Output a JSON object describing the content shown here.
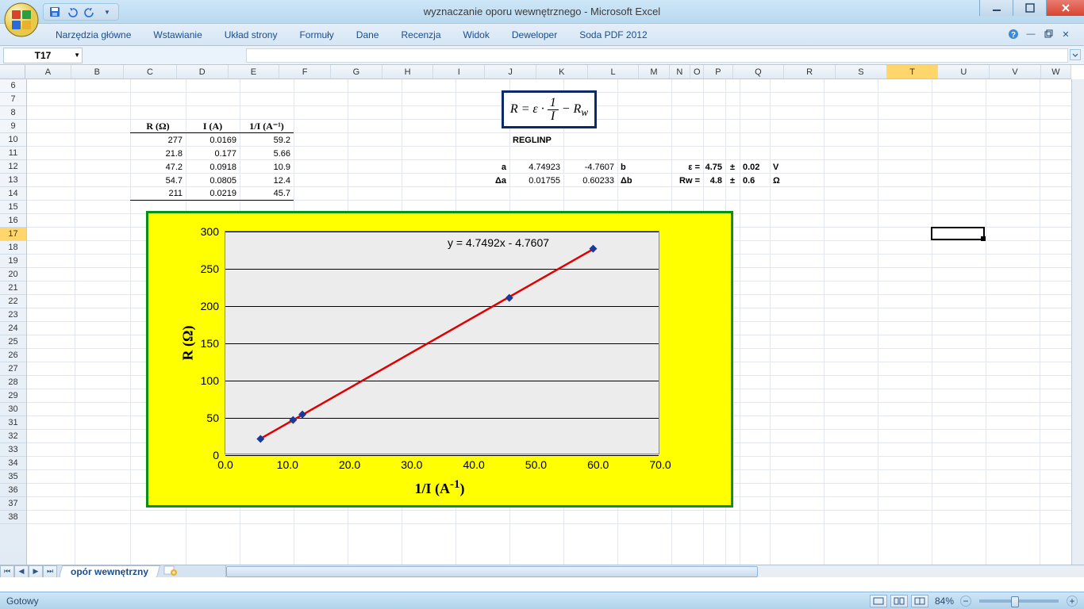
{
  "window": {
    "title": "wyznaczanie oporu wewnętrznego - Microsoft Excel"
  },
  "ribbon_tabs": [
    "Narzędzia główne",
    "Wstawianie",
    "Układ strony",
    "Formuły",
    "Dane",
    "Recenzja",
    "Widok",
    "Deweloper",
    "Soda PDF 2012"
  ],
  "name_box": "T17",
  "columns": [
    {
      "l": "A",
      "w": 60
    },
    {
      "l": "B",
      "w": 70
    },
    {
      "l": "C",
      "w": 70
    },
    {
      "l": "D",
      "w": 68
    },
    {
      "l": "E",
      "w": 68
    },
    {
      "l": "F",
      "w": 68
    },
    {
      "l": "G",
      "w": 68
    },
    {
      "l": "H",
      "w": 68
    },
    {
      "l": "I",
      "w": 68
    },
    {
      "l": "J",
      "w": 68
    },
    {
      "l": "K",
      "w": 68
    },
    {
      "l": "L",
      "w": 68
    },
    {
      "l": "M",
      "w": 40
    },
    {
      "l": "N",
      "w": 28
    },
    {
      "l": "O",
      "w": 18
    },
    {
      "l": "P",
      "w": 38
    },
    {
      "l": "Q",
      "w": 68
    },
    {
      "l": "R",
      "w": 68
    },
    {
      "l": "S",
      "w": 68
    },
    {
      "l": "T",
      "w": 68
    },
    {
      "l": "U",
      "w": 68
    },
    {
      "l": "V",
      "w": 68
    },
    {
      "l": "W",
      "w": 40
    }
  ],
  "row_start": 6,
  "row_end": 38,
  "active_col": "T",
  "active_row": 17,
  "table": {
    "headers": {
      "c": "R (Ω)",
      "d": "I (A)",
      "e": "1/I (A⁻¹)"
    },
    "rows": [
      {
        "c": "277",
        "d": "0.0169",
        "e": "59.2"
      },
      {
        "c": "21.8",
        "d": "0.177",
        "e": "5.66"
      },
      {
        "c": "47.2",
        "d": "0.0918",
        "e": "10.9"
      },
      {
        "c": "54.7",
        "d": "0.0805",
        "e": "12.4"
      },
      {
        "c": "211",
        "d": "0.0219",
        "e": "45.7"
      }
    ]
  },
  "formula_image": "R = ε · 1/I − Rw",
  "reglinp": {
    "label": "REGLINP",
    "a_label": "a",
    "a_val": "4.74923",
    "b_val": "-4.7607",
    "b_label": "b",
    "da_label": "Δa",
    "da_val": "0.01755",
    "db_val": "0.60233",
    "db_label": "Δb"
  },
  "results": {
    "eps_label": "ε =",
    "eps_val": "4.75",
    "pm1": "±",
    "eps_err": "0.02",
    "eps_unit": "V",
    "rw_label": "Rw =",
    "rw_val": "4.8",
    "pm2": "±",
    "rw_err": "0.6",
    "rw_unit": "Ω"
  },
  "chart_data": {
    "type": "scatter",
    "equation": "y = 4.7492x - 4.7607",
    "xlabel": "1/I (A⁻¹)",
    "ylabel": "R (Ω)",
    "xlim": [
      0,
      70
    ],
    "ylim": [
      0,
      300
    ],
    "xticks": [
      0.0,
      10.0,
      20.0,
      30.0,
      40.0,
      50.0,
      60.0,
      70.0
    ],
    "yticks": [
      0,
      50,
      100,
      150,
      200,
      250,
      300
    ],
    "points": [
      {
        "x": 5.66,
        "y": 21.8
      },
      {
        "x": 10.9,
        "y": 47.2
      },
      {
        "x": 12.4,
        "y": 54.7
      },
      {
        "x": 45.7,
        "y": 211
      },
      {
        "x": 59.2,
        "y": 277
      }
    ],
    "trend": {
      "slope": 4.7492,
      "intercept": -4.7607
    }
  },
  "sheet_tab": "opór wewnętrzny",
  "status_text": "Gotowy",
  "zoom": "84%"
}
